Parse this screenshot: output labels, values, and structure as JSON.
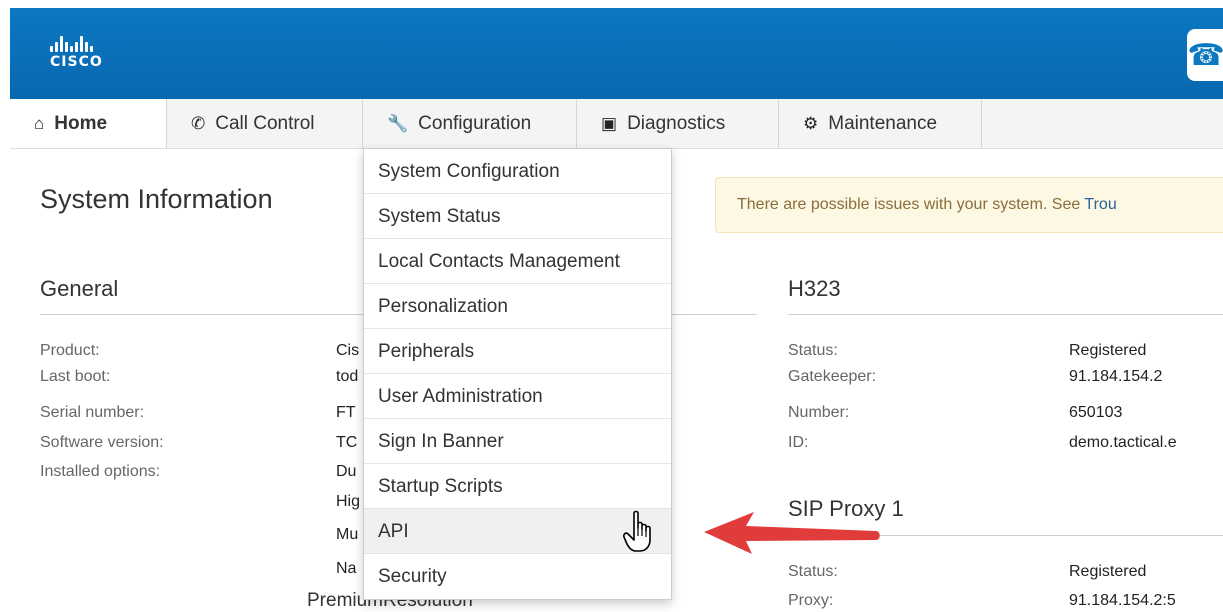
{
  "header": {
    "logo_text": "CISCO",
    "phone_icon": "phone-icon"
  },
  "nav": {
    "tabs": [
      {
        "label": "Home",
        "icon": "home-icon"
      },
      {
        "label": "Call Control",
        "icon": "phone-icon"
      },
      {
        "label": "Configuration",
        "icon": "wrench-icon"
      },
      {
        "label": "Diagnostics",
        "icon": "medkit-icon"
      },
      {
        "label": "Maintenance",
        "icon": "gear-icon"
      }
    ]
  },
  "page": {
    "title": "System Information",
    "alert_text": "There are possible issues with your system. See ",
    "alert_link": "Trou"
  },
  "general": {
    "title": "General",
    "labels": [
      "Product:",
      "Last boot:",
      "Serial number:",
      "Software version:",
      "Installed options:"
    ],
    "values": [
      "Cis",
      "tod",
      "FT",
      "TC",
      "Du",
      "Hig",
      "Mu",
      "Na"
    ],
    "partial_bottom": "PremiumResolution"
  },
  "h323": {
    "title": "H323",
    "labels": [
      "Status:",
      "Gatekeeper:",
      "Number:",
      "ID:"
    ],
    "values": [
      "Registered",
      "91.184.154.2",
      "650103",
      "demo.tactical.e"
    ]
  },
  "sip": {
    "title": "SIP Proxy 1",
    "labels": [
      "Status:",
      "Proxy:"
    ],
    "values": [
      "Registered",
      "91.184.154.2:5"
    ]
  },
  "dropdown": {
    "items": [
      "System Configuration",
      "System Status",
      "Local Contacts Management",
      "Personalization",
      "Peripherals",
      "User Administration",
      "Sign In Banner",
      "Startup Scripts",
      "API",
      "Security"
    ],
    "hovered": "API"
  },
  "colors": {
    "header_blue": "#0b78c2",
    "alert_bg": "#fcf8e3",
    "arrow_red": "#e03c3c"
  }
}
